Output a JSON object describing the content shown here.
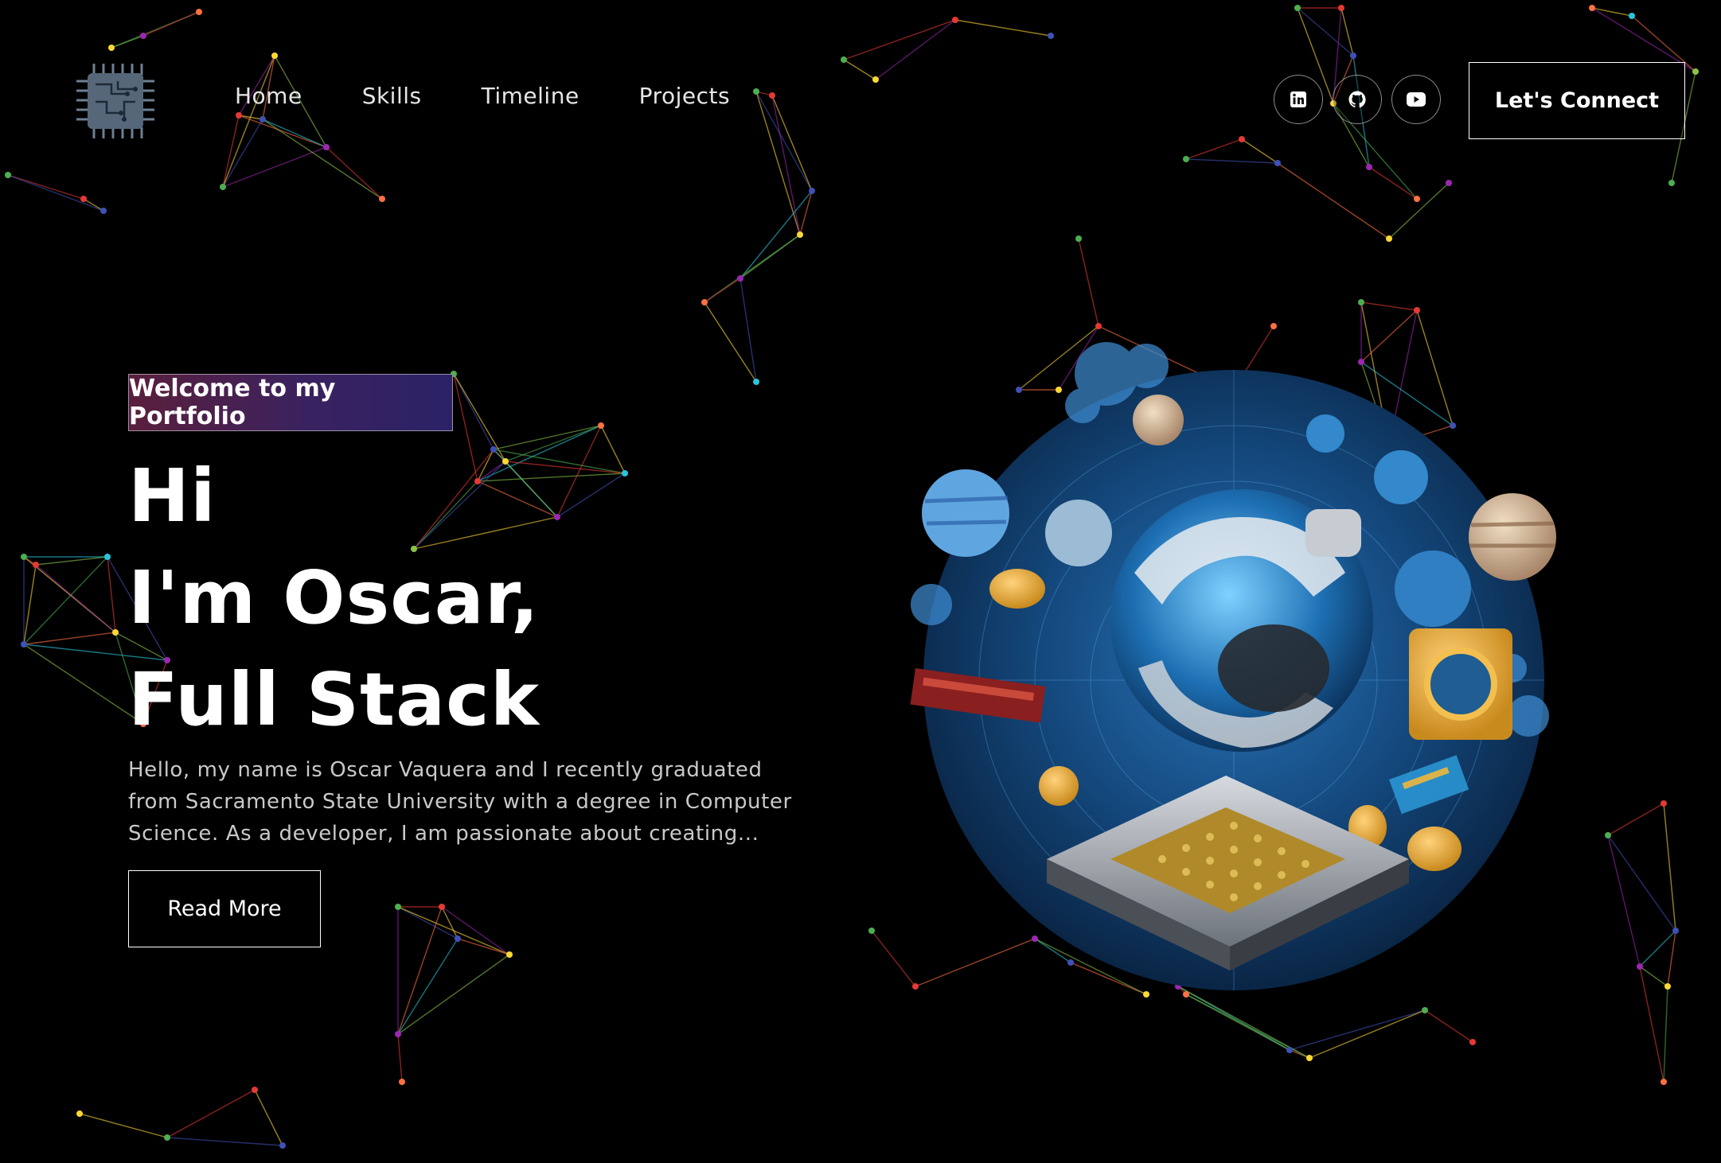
{
  "nav": {
    "items": [
      {
        "label": "Home"
      },
      {
        "label": "Skills"
      },
      {
        "label": "Timeline"
      },
      {
        "label": "Projects"
      }
    ]
  },
  "socials": [
    {
      "icon": "linkedin-icon"
    },
    {
      "icon": "github-icon"
    },
    {
      "icon": "youtube-icon"
    }
  ],
  "header": {
    "connect_label": "Let's Connect",
    "logo_icon": "cpu-chip-icon"
  },
  "hero": {
    "badge": "Welcome to my Portfolio",
    "title_line1": "Hi",
    "title_line2": "I'm Oscar,",
    "title_line3": "Full Stack",
    "intro": "Hello, my name is Oscar Vaquera and I recently graduated from Sacramento State University with a degree in Computer Science. As a developer, I am passionate about creating...",
    "read_more": "Read More"
  },
  "colors": {
    "background": "#000000",
    "badge_gradient_start": "#5a1f3c",
    "badge_gradient_end": "#2b2266",
    "text_secondary": "#c9c9c9"
  }
}
